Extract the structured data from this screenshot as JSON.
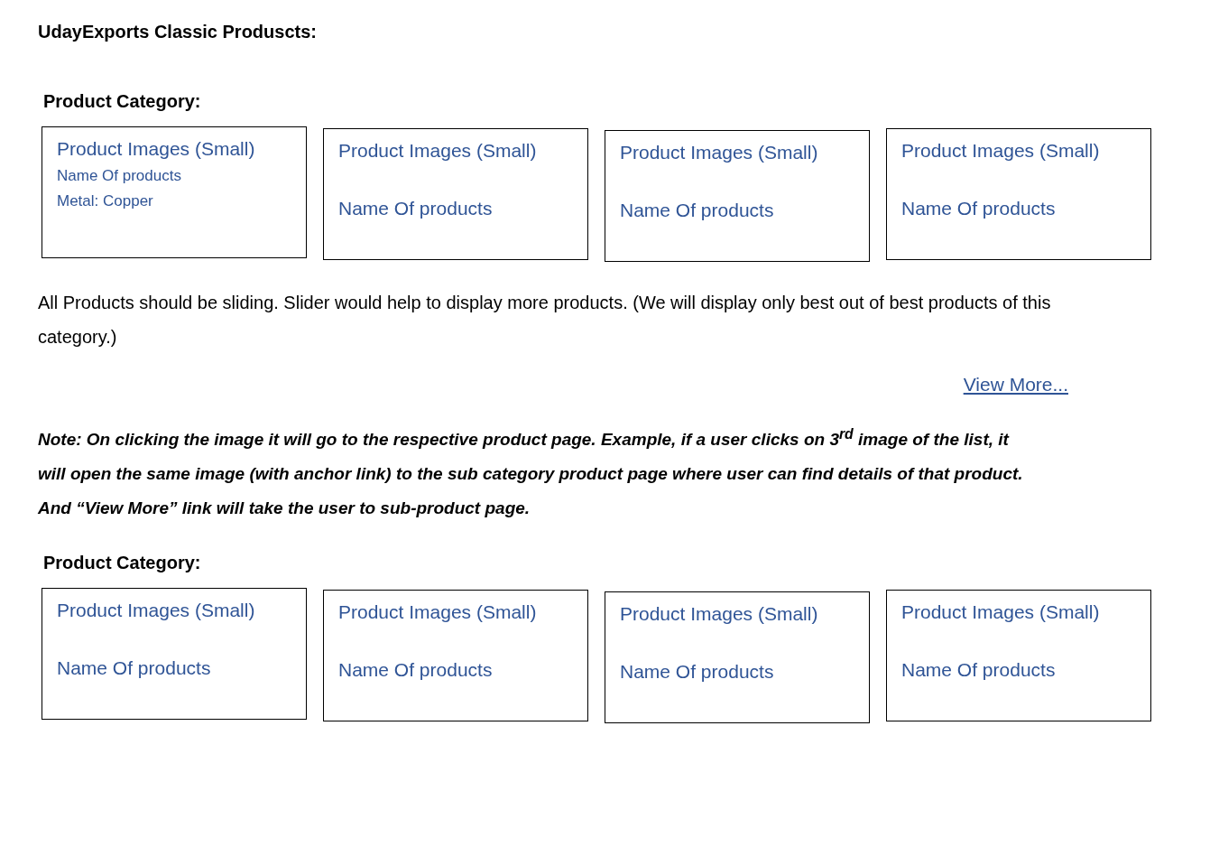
{
  "title": "UdayExports Classic Produscts:",
  "sections": [
    {
      "heading": "Product Category:",
      "cards": [
        {
          "kind": "detailed",
          "image_label": "Product Images (Small)",
          "lines": [
            "Name Of products",
            "Metal: Copper"
          ]
        },
        {
          "kind": "simple",
          "image_label": "Product Images (Small)",
          "lines": [
            "Name Of products"
          ]
        },
        {
          "kind": "simple",
          "image_label": "Product Images (Small)",
          "lines": [
            "Name Of products"
          ]
        },
        {
          "kind": "simple",
          "image_label": "Product Images (Small)",
          "lines": [
            "Name Of products"
          ]
        }
      ],
      "paragraph": "All Products should be sliding. Slider would help to display more products. (We will display only best out of best products of this category.)",
      "link": "View More...",
      "note": "Note: On clicking the image it will go to the respective product page. Example, if a user clicks on 3$^{rd}$ image of the list, it will open the same image (with anchor link) to the sub category product page where user can find details of that product. And “View More” link will take the user to sub-product page."
    },
    {
      "heading": "Product Category:",
      "cards": [
        {
          "kind": "simple",
          "image_label": "Product Images (Small)",
          "lines": [
            "Name Of products"
          ]
        },
        {
          "kind": "simple",
          "image_label": "Product Images (Small)",
          "lines": [
            "Name Of products"
          ]
        },
        {
          "kind": "simple",
          "image_label": "Product Images (Small)",
          "lines": [
            "Name Of products"
          ]
        },
        {
          "kind": "simple",
          "image_label": "Product Images (Small)",
          "lines": [
            "Name Of products"
          ]
        }
      ]
    }
  ]
}
